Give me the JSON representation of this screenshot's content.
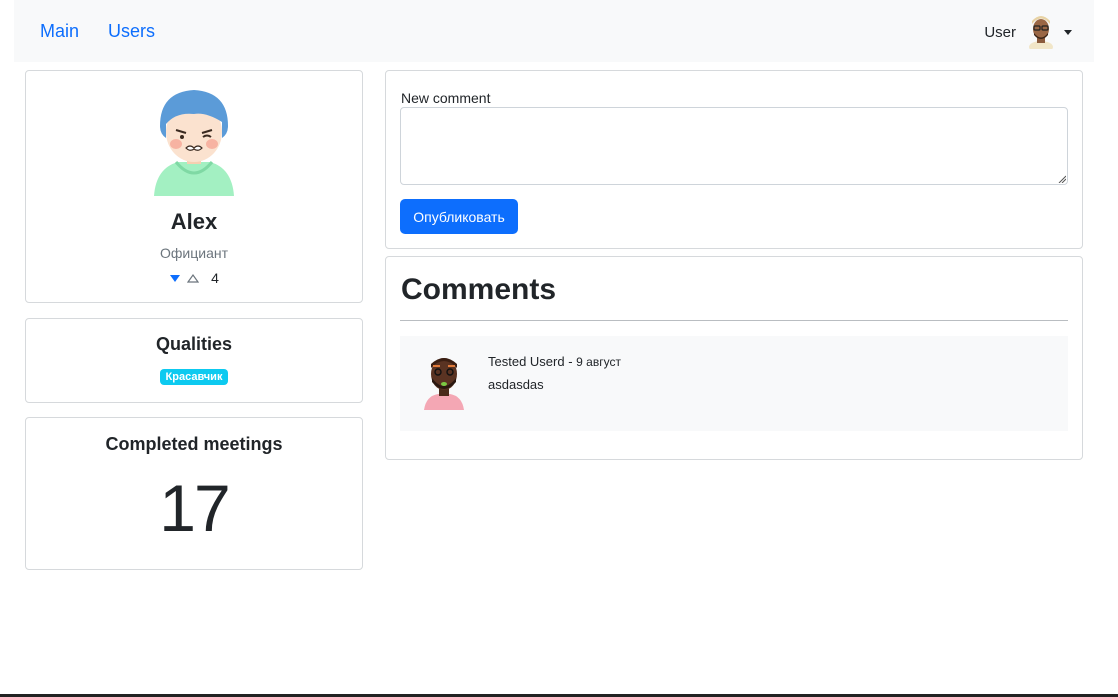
{
  "nav": {
    "links": [
      "Main",
      "Users"
    ],
    "user_label": "User",
    "user_avatar_icon": "user-avatar-icon",
    "dropdown_icon": "caret-down-icon"
  },
  "profile": {
    "name": "Alex",
    "profession": "Официант",
    "rate": "4",
    "avatar_icon": "profile-avatar-icon",
    "rate_up_icon": "triangle-up-outline-icon",
    "rate_down_icon": "triangle-down-filled-icon"
  },
  "qualities": {
    "title": "Qualities",
    "badges": [
      "Красавчик"
    ],
    "badge_color": "#0dcaf0"
  },
  "meetings": {
    "title": "Completed meetings",
    "count": "17"
  },
  "new_comment": {
    "label": "New comment",
    "textarea_value": "",
    "submit_label": "Опубликовать",
    "button_color": "#0d6efd"
  },
  "comments": {
    "title": "Comments",
    "items": [
      {
        "author": "Tested Userd",
        "separator": " - ",
        "date": "9 август",
        "text": "asdasdas",
        "avatar_icon": "commenter-avatar-icon"
      }
    ]
  },
  "colors": {
    "link": "#0d6efd",
    "navbar_bg": "#f8f9fa",
    "muted_text": "#6c757d"
  }
}
